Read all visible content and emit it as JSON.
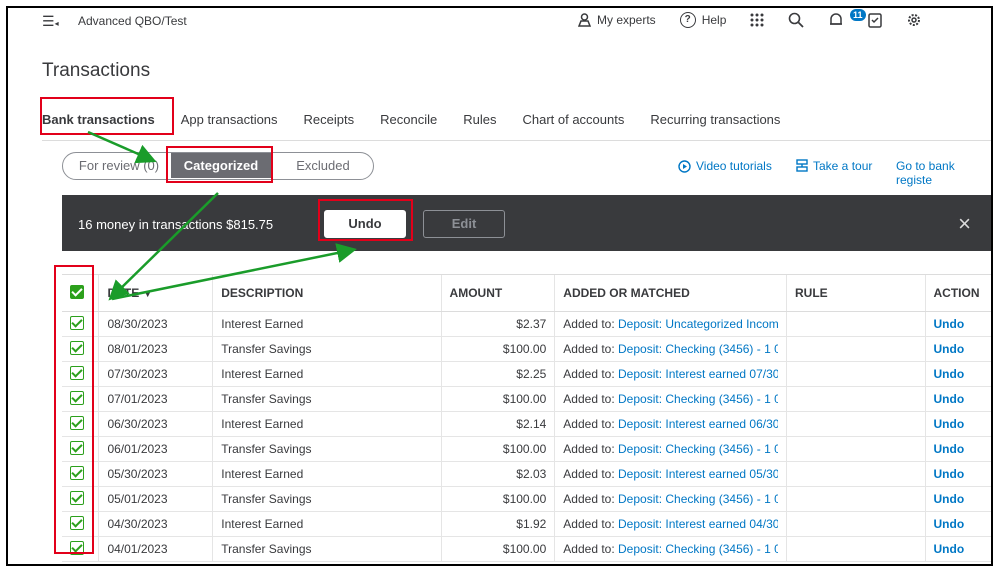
{
  "topbar": {
    "company": "Advanced QBO/Test",
    "my_experts": "My experts",
    "help": "Help",
    "help_glyph": "?",
    "notifications_count": "11"
  },
  "page": {
    "title": "Transactions"
  },
  "tabs": [
    {
      "label": "Bank transactions",
      "active": true
    },
    {
      "label": "App transactions"
    },
    {
      "label": "Receipts"
    },
    {
      "label": "Reconcile"
    },
    {
      "label": "Rules"
    },
    {
      "label": "Chart of accounts"
    },
    {
      "label": "Recurring transactions"
    }
  ],
  "filter": {
    "for_review": "For review (0)",
    "categorized": "Categorized",
    "excluded": "Excluded"
  },
  "links": {
    "video_tutorials": "Video tutorials",
    "take_a_tour": "Take a tour",
    "go_to_register": "Go to bank registe"
  },
  "banner": {
    "message": "16 money in transactions $815.75",
    "undo": "Undo",
    "edit": "Edit",
    "close": "×"
  },
  "table": {
    "headers": {
      "date": "DATE",
      "sort_glyph": "▼",
      "description": "DESCRIPTION",
      "amount": "AMOUNT",
      "added_or_matched": "ADDED OR MATCHED",
      "rule": "RULE",
      "action": "ACTION"
    },
    "added_prefix": "Added to:",
    "action_label": "Undo",
    "rows": [
      {
        "date": "08/30/2023",
        "description": "Interest Earned",
        "amount": "$2.37",
        "matched": "Deposit: Uncategorized Incom"
      },
      {
        "date": "08/01/2023",
        "description": "Transfer Savings",
        "amount": "$100.00",
        "matched": "Deposit: Checking (3456) - 1 0"
      },
      {
        "date": "07/30/2023",
        "description": "Interest Earned",
        "amount": "$2.25",
        "matched": "Deposit: Interest earned 07/30"
      },
      {
        "date": "07/01/2023",
        "description": "Transfer Savings",
        "amount": "$100.00",
        "matched": "Deposit: Checking (3456) - 1 0"
      },
      {
        "date": "06/30/2023",
        "description": "Interest Earned",
        "amount": "$2.14",
        "matched": "Deposit: Interest earned 06/30"
      },
      {
        "date": "06/01/2023",
        "description": "Transfer Savings",
        "amount": "$100.00",
        "matched": "Deposit: Checking (3456) - 1 0"
      },
      {
        "date": "05/30/2023",
        "description": "Interest Earned",
        "amount": "$2.03",
        "matched": "Deposit: Interest earned 05/30"
      },
      {
        "date": "05/01/2023",
        "description": "Transfer Savings",
        "amount": "$100.00",
        "matched": "Deposit: Checking (3456) - 1 0"
      },
      {
        "date": "04/30/2023",
        "description": "Interest Earned",
        "amount": "$1.92",
        "matched": "Deposit: Interest earned 04/30"
      },
      {
        "date": "04/01/2023",
        "description": "Transfer Savings",
        "amount": "$100.00",
        "matched": "Deposit: Checking (3456) - 1 0"
      }
    ]
  },
  "icons": [
    "hamburger-icon",
    "person-icon",
    "help-icon",
    "apps-grid-icon",
    "search-icon",
    "bell-icon",
    "clipboard-icon",
    "gear-icon",
    "play-circle-icon",
    "tour-icon"
  ],
  "colors": {
    "annotation_red": "#e2001a",
    "annotation_green": "#1a9c2a",
    "link_blue": "#0077c5",
    "check_green": "#2ca01c",
    "banner_dark": "#393a3d"
  }
}
